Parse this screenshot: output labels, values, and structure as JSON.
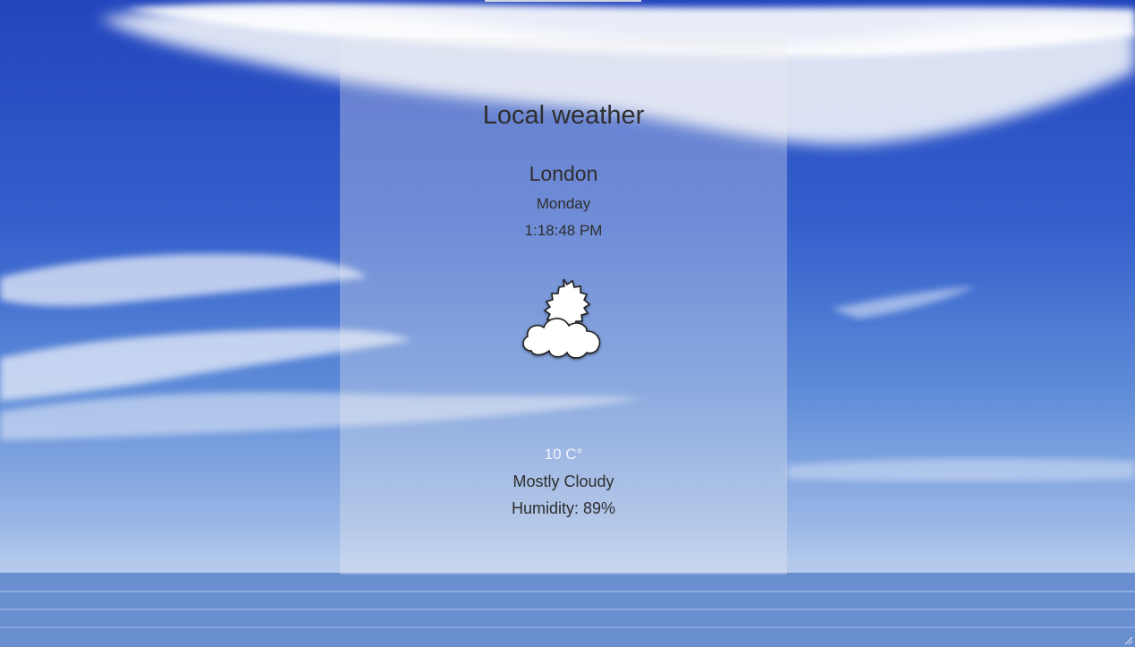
{
  "app": {
    "title": "Local weather"
  },
  "location": {
    "city": "London",
    "day": "Monday",
    "time": "1:18:48 PM"
  },
  "weather": {
    "icon": "partly-cloudy-icon",
    "temperature": "10 C°",
    "condition": "Mostly Cloudy",
    "humidity": "Humidity: 89%"
  },
  "colors": {
    "card_background": "#ebebf0",
    "temperature_text": "#f2f4f8",
    "text": "#2e2e2e"
  }
}
